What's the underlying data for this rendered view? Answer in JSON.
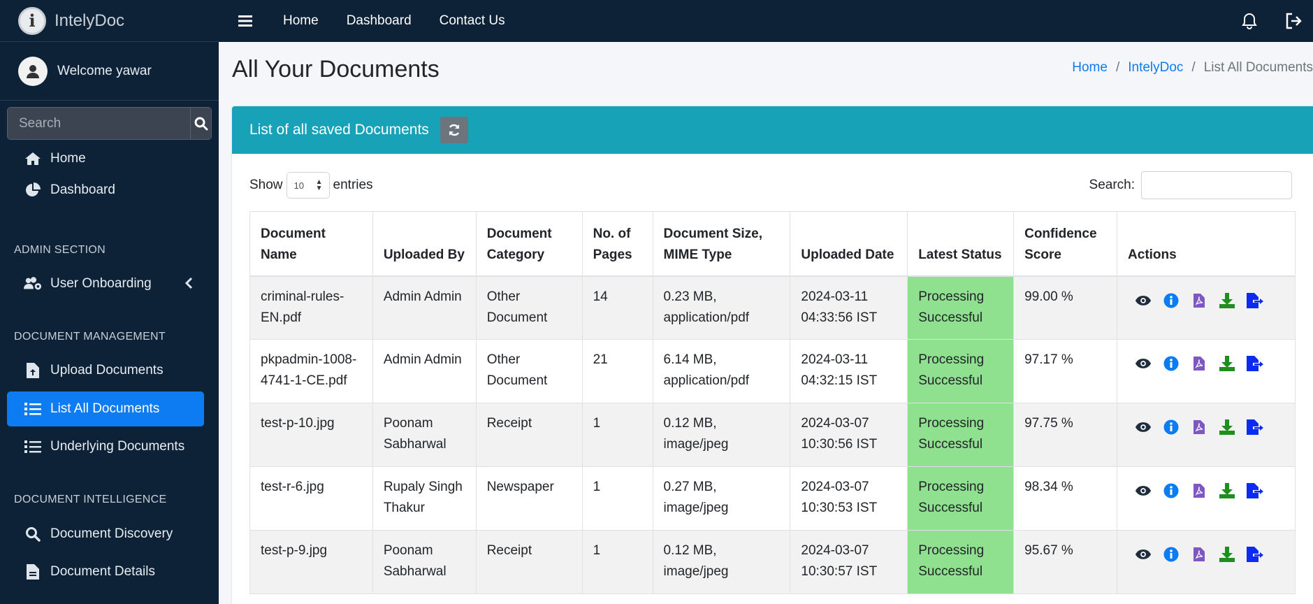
{
  "brand": {
    "name": "IntelyDoc",
    "logo_letter": "i"
  },
  "user": {
    "welcome": "Welcome yawar"
  },
  "sidebar": {
    "search_placeholder": "Search",
    "home": "Home",
    "dashboard": "Dashboard",
    "admin_header": "ADMIN SECTION",
    "user_onboarding": "User Onboarding",
    "docmgmt_header": "DOCUMENT MANAGEMENT",
    "upload": "Upload Documents",
    "list_all": "List All Documents",
    "underlying": "Underlying Documents",
    "docintel_header": "DOCUMENT INTELLIGENCE",
    "discovery": "Document Discovery",
    "details": "Document Details"
  },
  "topbar": {
    "home": "Home",
    "dashboard": "Dashboard",
    "contact": "Contact Us"
  },
  "page": {
    "title": "All Your Documents"
  },
  "breadcrumb": {
    "home": "Home",
    "app": "IntelyDoc",
    "current": "List All Documents",
    "sep": "/"
  },
  "card": {
    "title": "List of all saved Documents"
  },
  "table_controls": {
    "show": "Show",
    "entries_value": "10",
    "entries": "entries",
    "search_label": "Search:"
  },
  "table": {
    "headers": {
      "name_1": "Document",
      "name_2": "Name",
      "uploaded_by": "Uploaded By",
      "category_1": "Document",
      "category_2": "Category",
      "pages_1": "No. of",
      "pages_2": "Pages",
      "size_1": "Document Size,",
      "size_2": "MIME Type",
      "date": "Uploaded Date",
      "status": "Latest Status",
      "confidence_1": "Confidence",
      "confidence_2": "Score",
      "actions": "Actions"
    },
    "rows": [
      {
        "name_1": "criminal-rules-",
        "name_2": "EN.pdf",
        "by_1": "Admin Admin",
        "by_2": "",
        "cat_1": "Other",
        "cat_2": "Document",
        "pages": "14",
        "size_1": "0.23 MB,",
        "size_2": "application/pdf",
        "date_1": "2024-03-11",
        "date_2": "04:33:56 IST",
        "status_1": "Processing",
        "status_2": "Successful",
        "score": "99.00 %"
      },
      {
        "name_1": "pkpadmin-1008-",
        "name_2": "4741-1-CE.pdf",
        "by_1": "Admin Admin",
        "by_2": "",
        "cat_1": "Other",
        "cat_2": "Document",
        "pages": "21",
        "size_1": "6.14 MB,",
        "size_2": "application/pdf",
        "date_1": "2024-03-11",
        "date_2": "04:32:15 IST",
        "status_1": "Processing",
        "status_2": "Successful",
        "score": "97.17 %"
      },
      {
        "name_1": "test-p-10.jpg",
        "name_2": "",
        "by_1": "Poonam",
        "by_2": "Sabharwal",
        "cat_1": "Receipt",
        "cat_2": "",
        "pages": "1",
        "size_1": "0.12 MB,",
        "size_2": "image/jpeg",
        "date_1": "2024-03-07",
        "date_2": "10:30:56 IST",
        "status_1": "Processing",
        "status_2": "Successful",
        "score": "97.75 %"
      },
      {
        "name_1": "test-r-6.jpg",
        "name_2": "",
        "by_1": "Rupaly Singh",
        "by_2": "Thakur",
        "cat_1": "Newspaper",
        "cat_2": "",
        "pages": "1",
        "size_1": "0.27 MB,",
        "size_2": "image/jpeg",
        "date_1": "2024-03-07",
        "date_2": "10:30:53 IST",
        "status_1": "Processing",
        "status_2": "Successful",
        "score": "98.34 %"
      },
      {
        "name_1": "test-p-9.jpg",
        "name_2": "",
        "by_1": "Poonam",
        "by_2": "Sabharwal",
        "cat_1": "Receipt",
        "cat_2": "",
        "pages": "1",
        "size_1": "0.12 MB,",
        "size_2": "image/jpeg",
        "date_1": "2024-03-07",
        "date_2": "10:30:57 IST",
        "status_1": "Processing",
        "status_2": "Successful",
        "score": "95.67 %"
      }
    ]
  },
  "colors": {
    "sidebar_bg": "#0d2137",
    "active": "#0d7cf2",
    "header": "#17a2b8",
    "status_ok": "#8fe08f",
    "view": "#1f2d3d",
    "info": "#0d7cf2",
    "pdf": "#7e57c2",
    "download": "#1e8e1e",
    "export": "#0b2cf0"
  },
  "icons": [
    "menu-icon",
    "bell-icon",
    "logout-icon",
    "home-icon",
    "chart-pie-icon",
    "users-cog-icon",
    "file-upload-icon",
    "list-icon",
    "search-doc-icon",
    "file-icon",
    "refresh-icon",
    "eye-icon",
    "info-icon",
    "pdf-icon",
    "download-icon",
    "export-icon"
  ]
}
